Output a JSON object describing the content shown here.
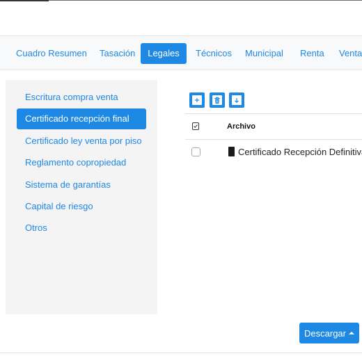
{
  "tabs": [
    {
      "label": "Cuadro Resumen",
      "active": false
    },
    {
      "label": "Tasación",
      "active": false
    },
    {
      "label": "Legales",
      "active": true
    },
    {
      "label": "Técnicos",
      "active": false
    },
    {
      "label": "Municipal",
      "active": false
    },
    {
      "label": "Renta",
      "active": false
    },
    {
      "label": "Venta",
      "active": false
    }
  ],
  "sidebar": {
    "items": [
      {
        "label": "Escritura compra venta",
        "active": false
      },
      {
        "label": "Certificado recepción final",
        "active": true
      },
      {
        "label": "Certificado ley venta por piso",
        "active": false
      },
      {
        "label": "Reglamento copropiedad",
        "active": false
      },
      {
        "label": "Sistema de garantías",
        "active": false
      },
      {
        "label": "Capital de riesgo",
        "active": false
      },
      {
        "label": "Otros",
        "active": false
      }
    ]
  },
  "toolbar": {
    "buttons": [
      {
        "icon": "plus-icon"
      },
      {
        "icon": "trash-icon"
      },
      {
        "icon": "download-arrow-icon"
      }
    ]
  },
  "files": {
    "column_header": "Archivo",
    "rows": [
      {
        "name": "Certificado Recepción Definitiva.",
        "icon": "file-icon",
        "checked": false
      }
    ]
  },
  "actions": {
    "download_label": "Descargar"
  },
  "colors": {
    "accent": "#1e88e5",
    "tabbar_bg": "#f8f9fa",
    "sidebar_bg": "#f4f4f4"
  }
}
